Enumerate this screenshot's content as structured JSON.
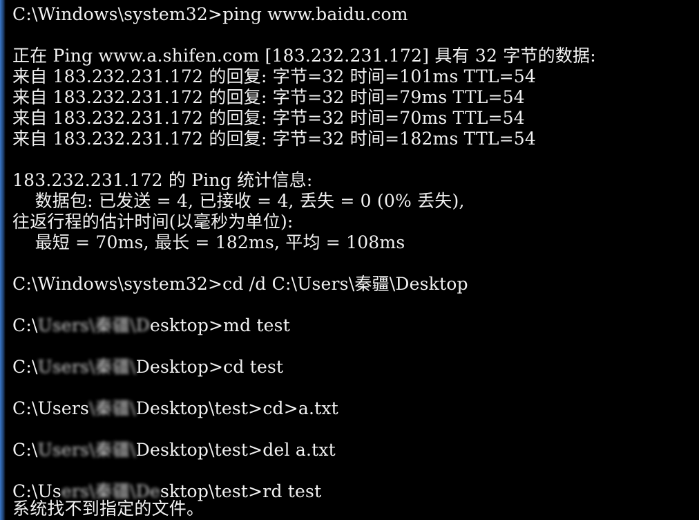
{
  "colors": {
    "background": "#000000",
    "text": "#f2f2f2",
    "left_edge": "#3a78c8"
  },
  "lines": [
    "C:\\Windows\\system32>ping www.baidu.com",
    "正在 Ping www.a.shifen.com [183.232.231.172] 具有 32 字节的数据:",
    "来自 183.232.231.172 的回复: 字节=32 时间=101ms TTL=54",
    "来自 183.232.231.172 的回复: 字节=32 时间=79ms TTL=54",
    "来自 183.232.231.172 的回复: 字节=32 时间=70ms TTL=54",
    "来自 183.232.231.172 的回复: 字节=32 时间=182ms TTL=54",
    "183.232.231.172 的 Ping 统计信息:",
    "    数据包: 已发送 = 4, 已接收 = 4, 丢失 = 0 (0% 丢失),",
    "往返行程的估计时间(以毫秒为单位):",
    "    最短 = 70ms, 最长 = 182ms, 平均 = 108ms",
    "C:\\Windows\\system32>cd /d C:\\Users\\秦疆\\Desktop",
    "系统找不到指定的文件。"
  ],
  "masked_prompts": [
    {
      "prefix": "C:\\",
      "hidden": "Users\\秦疆\\D",
      "suffix": "esktop>md test"
    },
    {
      "prefix": "C:\\",
      "hidden": "Users\\秦疆\\",
      "suffix": "Desktop>cd test"
    },
    {
      "prefix": "C:\\Users",
      "hidden": "\\秦疆\\",
      "suffix": "Desktop\\test>cd>a.txt"
    },
    {
      "prefix": "C:\\",
      "hidden": "Users\\秦疆\\",
      "suffix": "Desktop\\test>del a.txt"
    },
    {
      "prefix": "C:\\Us",
      "hidden": "ers\\秦疆\\De",
      "suffix": "sktop\\test>rd test"
    }
  ]
}
